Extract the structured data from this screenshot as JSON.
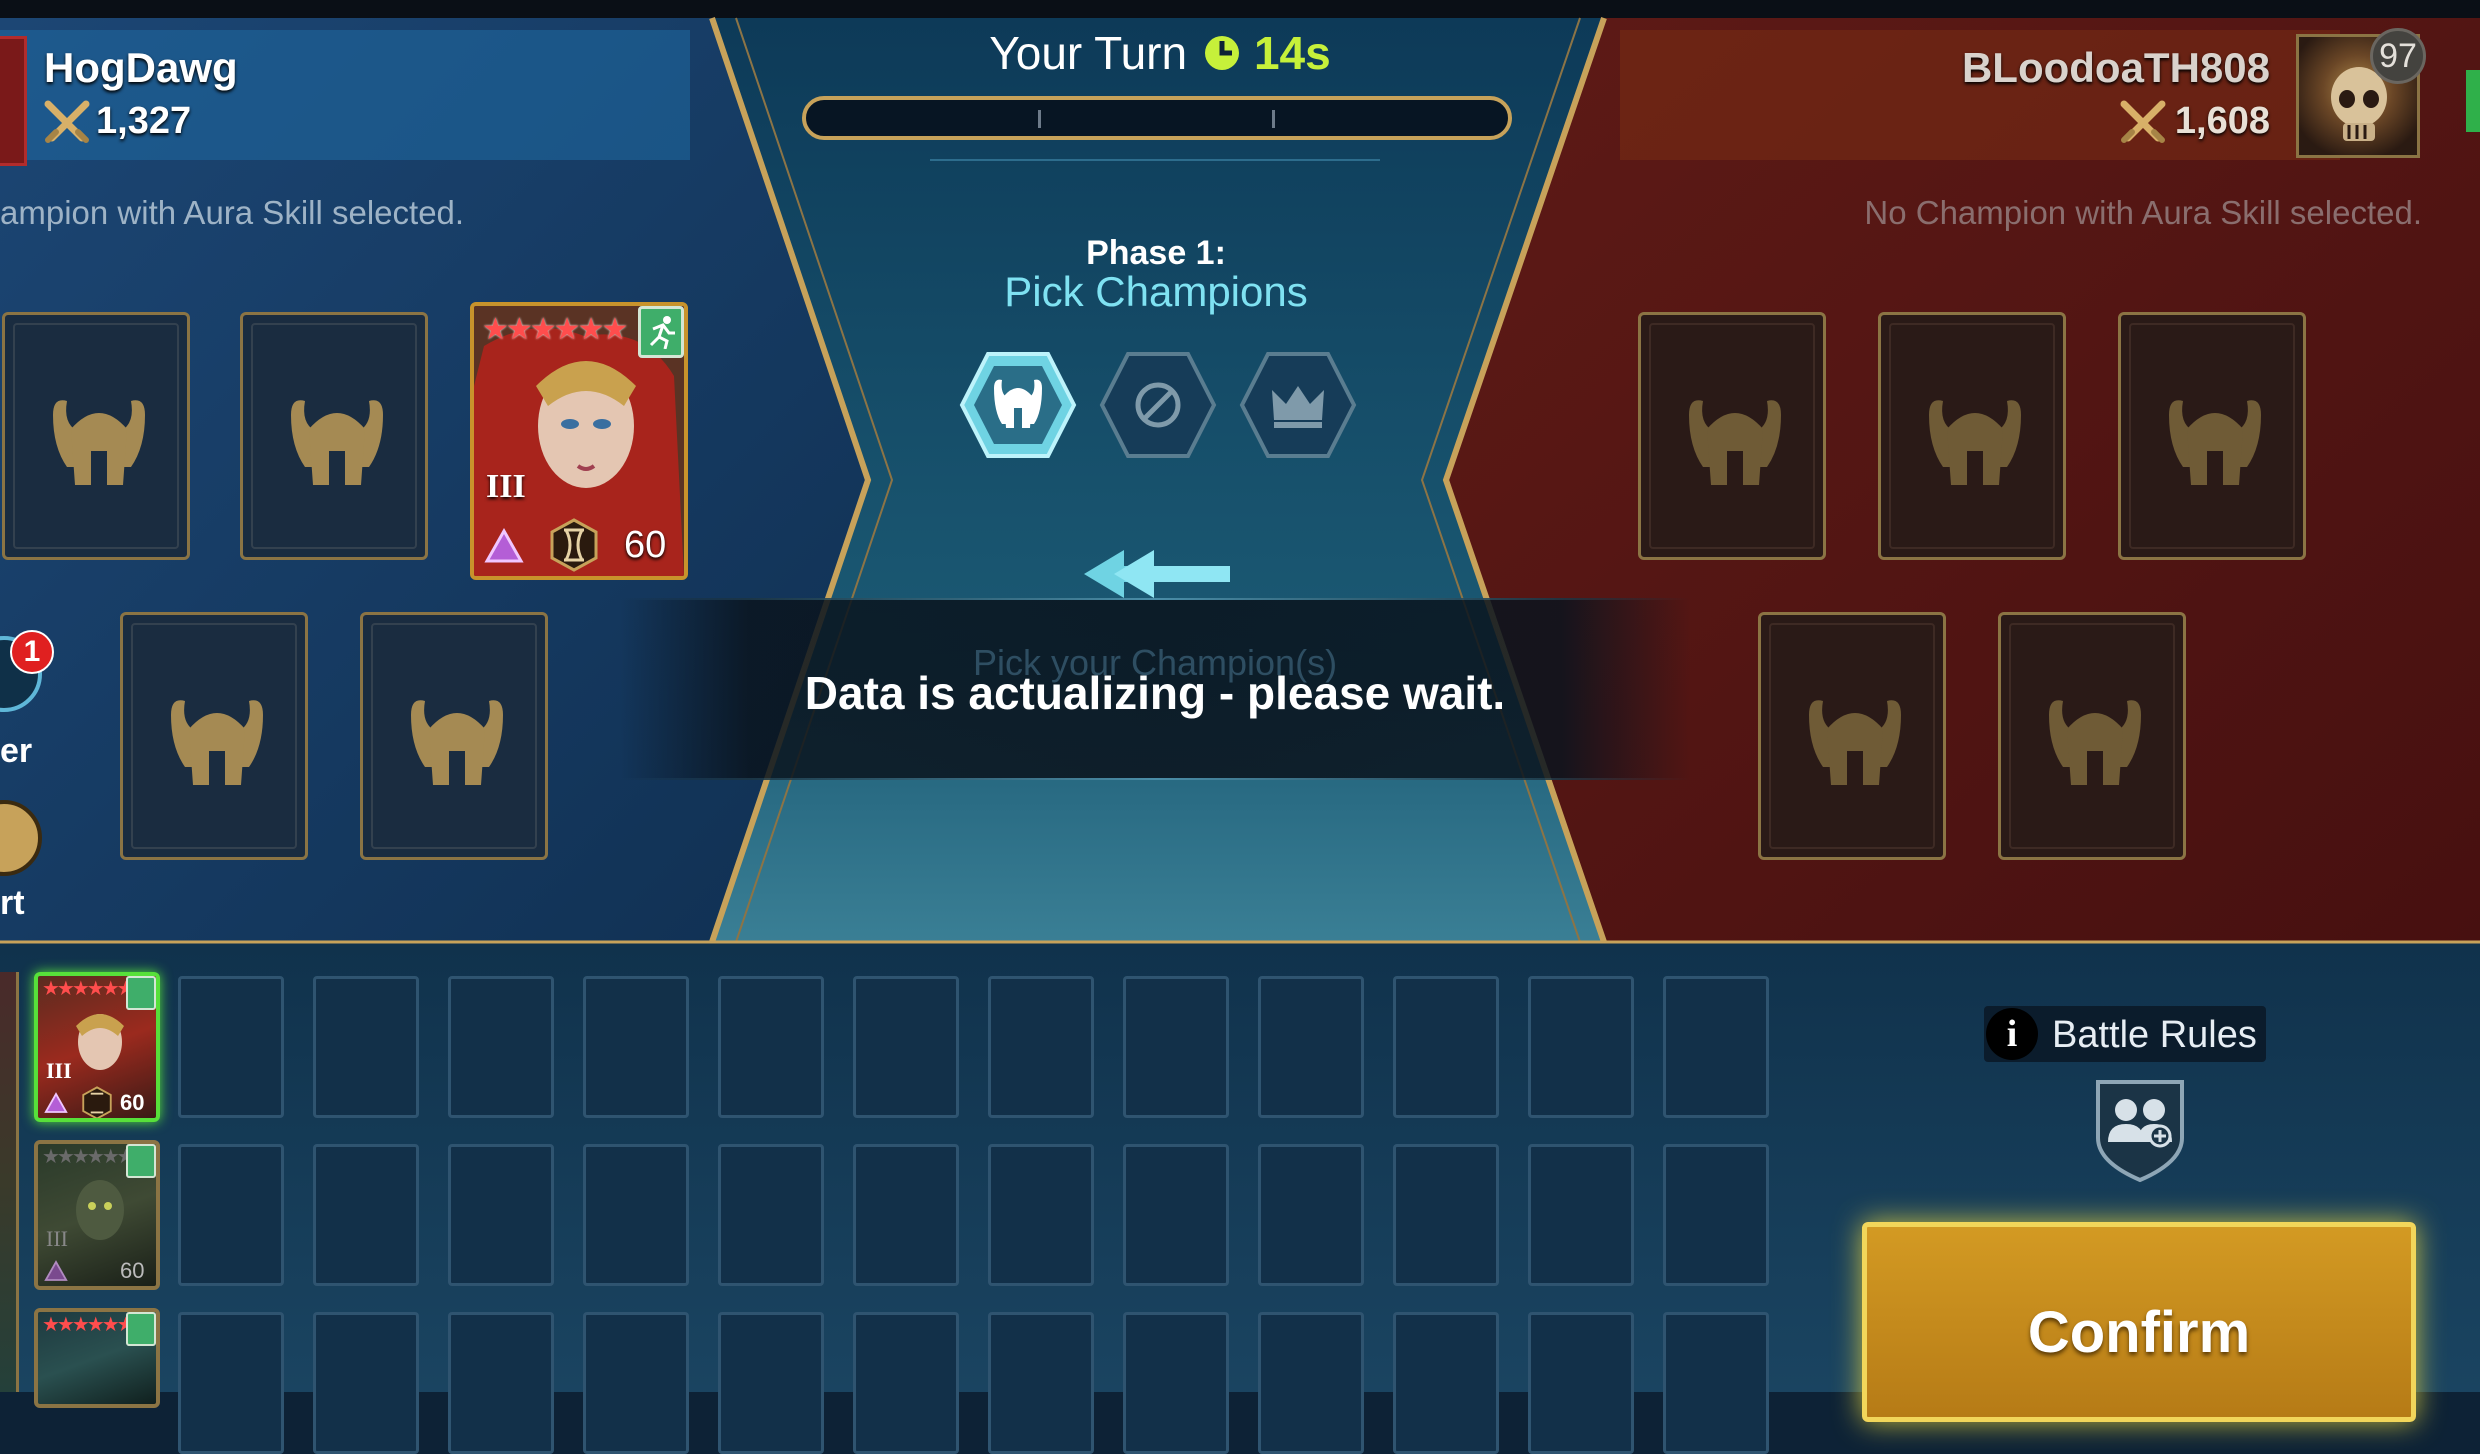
{
  "header": {
    "turn_label": "Your Turn",
    "timer": "14s"
  },
  "left_player": {
    "name": "HogDawg",
    "power": "1,327",
    "aura_text": "ampion with Aura Skill selected.",
    "side_badge_count": "1",
    "side_label_1": "er",
    "side_label_2": "rt"
  },
  "right_player": {
    "name": "BLoodoaTH808",
    "power": "1,608",
    "level": "97",
    "aura_text": "No Champion with Aura Skill selected."
  },
  "phase": {
    "title": "Phase 1:",
    "subtitle": "Pick Champions",
    "hint": "Pick your Champion(s)",
    "steps": [
      "pick-helmet-icon",
      "ban-icon",
      "leader-crown-icon"
    ]
  },
  "picked_champion": {
    "rank_numeral": "III",
    "level": "60",
    "stars": 6
  },
  "overlay": {
    "message": "Data is actualizing - please wait."
  },
  "roster": [
    {
      "rank_numeral": "III",
      "level": "60",
      "selected": true
    },
    {
      "rank_numeral": "III",
      "level": "60",
      "selected": false
    },
    {
      "rank_numeral": "",
      "level": "",
      "selected": false
    }
  ],
  "battle_rules": {
    "label": "Battle Rules"
  },
  "confirm": {
    "label": "Confirm"
  },
  "colors": {
    "left_panel": "#163a63",
    "right_panel": "#5a1414",
    "gold_border": "#c7a25a",
    "timer_green": "#c6f03a",
    "accent_cyan": "#7fe2f2"
  }
}
